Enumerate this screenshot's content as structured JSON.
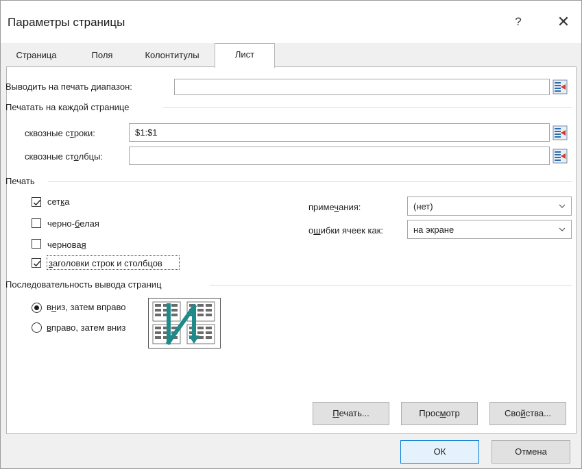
{
  "window": {
    "title": "Параметры страницы",
    "help_glyph": "?",
    "close_glyph": "✕"
  },
  "tabs": [
    {
      "label": "Страница",
      "active": false
    },
    {
      "label": "Поля",
      "active": false
    },
    {
      "label": "Колонтитулы",
      "active": false
    },
    {
      "label": "Лист",
      "active": true
    }
  ],
  "print_area": {
    "label": "Выводить на печать диапазон:",
    "value": ""
  },
  "titles": {
    "section_label": "Печатать на каждой странице",
    "rows": {
      "label_pre": "сквозные с",
      "label_ul": "т",
      "label_post": "роки:",
      "value": "$1:$1"
    },
    "cols": {
      "label_pre": "сквозные ст",
      "label_ul": "о",
      "label_post": "лбцы:",
      "value": ""
    }
  },
  "print": {
    "section_label": "Печать",
    "gridlines": {
      "pre": "сет",
      "ul": "к",
      "post": "а",
      "checked": true
    },
    "black_white": {
      "pre": "черно-",
      "ul": "б",
      "post": "елая",
      "checked": false
    },
    "draft": {
      "pre": "чернова",
      "ul": "я",
      "post": "",
      "checked": false
    },
    "headings": {
      "pre": "",
      "ul": "з",
      "post": "аголовки строк и столбцов",
      "checked": true
    },
    "comments": {
      "pre": "приме",
      "ul": "ч",
      "post": "ания:",
      "value": "(нет)"
    },
    "errors": {
      "pre": "о",
      "ul": "ш",
      "post": "ибки ячеек как:",
      "value": "на экране"
    }
  },
  "page_order": {
    "section_label": "Последовательность вывода страниц",
    "down_then_over": {
      "pre": "в",
      "ul": "н",
      "post": "из, затем вправо",
      "selected": true
    },
    "over_then_down": {
      "pre": "",
      "ul": "в",
      "post": "право, затем вниз",
      "selected": false
    },
    "preview_icon": "page-order-down-then-over-icon"
  },
  "buttons": {
    "print": {
      "pre": "",
      "ul": "П",
      "post": "ечать..."
    },
    "preview": {
      "pre": "Прос",
      "ul": "м",
      "post": "отр"
    },
    "options": {
      "pre": "Сво",
      "ul": "й",
      "post": "ства..."
    },
    "ok": "ОК",
    "cancel": "Отмена"
  },
  "colors": {
    "accent": "#0078d7",
    "arrow": "#1f8a8a"
  }
}
